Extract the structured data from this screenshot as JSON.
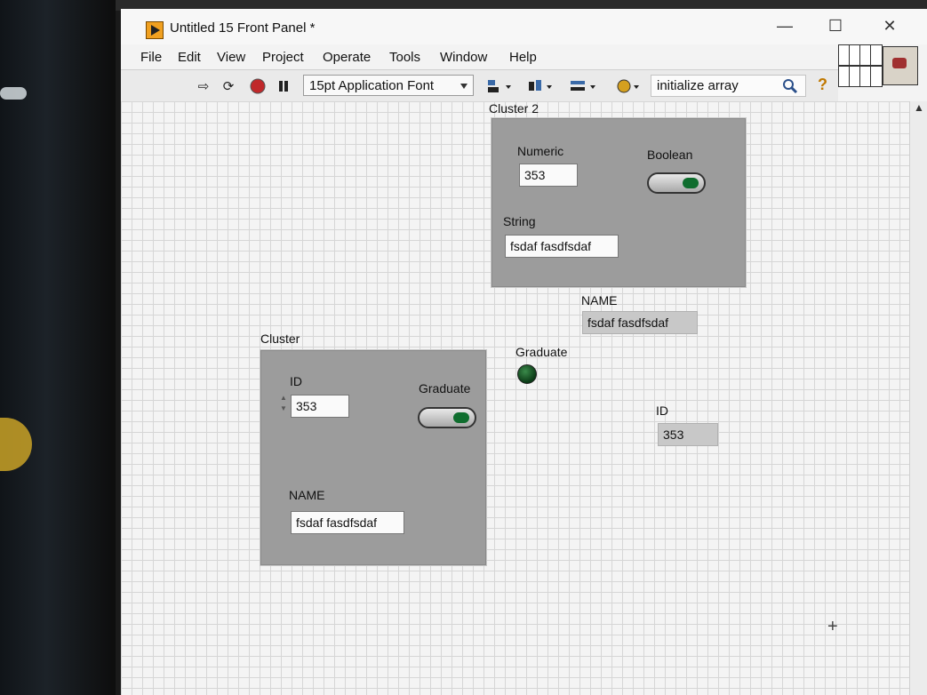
{
  "window": {
    "title": "Untitled 15 Front Panel *",
    "controls": {
      "minimize": "—",
      "maximize": "☐",
      "close": "✕"
    }
  },
  "menubar": {
    "items": [
      "File",
      "Edit",
      "View",
      "Project",
      "Operate",
      "Tools",
      "Window",
      "Help"
    ]
  },
  "toolbar": {
    "font": "15pt Application Font",
    "search_text": "initialize array",
    "help": "?"
  },
  "panel": {
    "cluster2": {
      "label": "Cluster 2",
      "numeric_label": "Numeric",
      "numeric_value": "353",
      "boolean_label": "Boolean",
      "string_label": "String",
      "string_value": "fsdaf fasdfsdaf"
    },
    "name_indicator": {
      "label": "NAME",
      "value": "fsdaf fasdfsdaf"
    },
    "graduate_indicator": {
      "label": "Graduate"
    },
    "id_indicator": {
      "label": "ID",
      "value": "353"
    },
    "cluster": {
      "label": "Cluster",
      "id_label": "ID",
      "id_value": "353",
      "graduate_label": "Graduate",
      "name_label": "NAME",
      "name_value": "fsdaf fasdfsdaf"
    }
  },
  "icons": [
    "run-arrow-icon",
    "run-continuously-icon",
    "abort-icon",
    "pause-icon",
    "align-icon",
    "distribute-icon",
    "resize-icon",
    "reorder-icon",
    "search-icon",
    "help-icon"
  ],
  "colors": {
    "led_green": "#0f6d2e",
    "app_icon": "#f0a020"
  }
}
